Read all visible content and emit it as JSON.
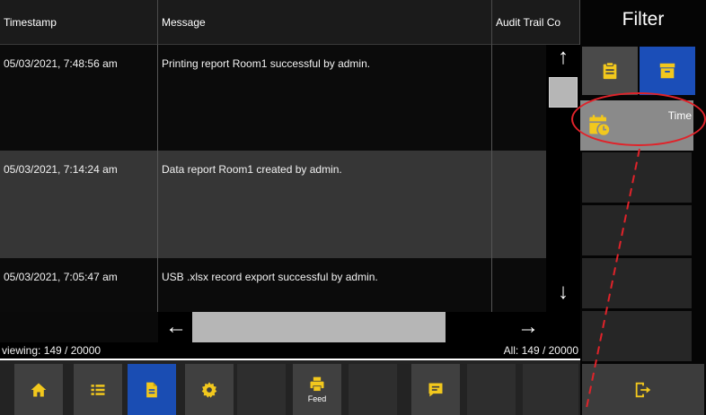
{
  "table": {
    "columns": [
      "Timestamp",
      "Message",
      "Audit Trail Co"
    ],
    "rows": [
      {
        "timestamp": "05/03/2021, 7:48:56 am",
        "message": "Printing report Room1 successful by admin.",
        "audit": ""
      },
      {
        "timestamp": "05/03/2021, 7:14:24 am",
        "message": "Data report Room1 created by admin.",
        "audit": ""
      },
      {
        "timestamp": "05/03/2021, 7:05:47 am",
        "message": "USB .xlsx record export successful by admin.",
        "audit": ""
      }
    ]
  },
  "status": {
    "viewing": "viewing: 149 / 20000",
    "all": "All: 149 / 20000"
  },
  "sidebar": {
    "title": "Filter",
    "time_label": "Time"
  },
  "bottom_bar": {
    "buttons": [
      {
        "icon": "home-icon",
        "label": ""
      },
      {
        "icon": "list-icon",
        "label": ""
      },
      {
        "icon": "document-icon",
        "label": "",
        "active": true
      },
      {
        "icon": "gear-icon",
        "label": ""
      },
      {
        "icon": "printer-icon",
        "label": "Feed"
      },
      {
        "icon": "comment-icon",
        "label": ""
      }
    ]
  },
  "colors": {
    "active_blue": "#1a4db3",
    "icon_yellow": "#f2c81d",
    "annotation_red": "#e0232a"
  }
}
